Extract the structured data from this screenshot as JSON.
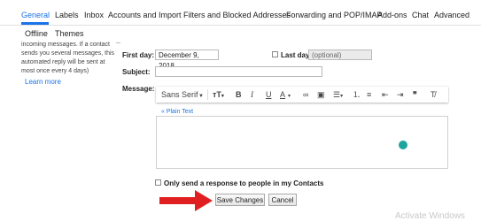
{
  "tabs": {
    "row1": [
      "General",
      "Labels",
      "Inbox",
      "Accounts and Import",
      "Filters and Blocked Addresses",
      "Forwarding and POP/IMAP",
      "Add-ons",
      "Chat",
      "Advanced"
    ],
    "row2": [
      "Offline",
      "Themes"
    ],
    "active": "General"
  },
  "help": {
    "text": "incoming messages. If a contact sends you several messages, this automated reply will be sent at most once every 4 days)",
    "learn_more": "Learn more"
  },
  "form": {
    "first_day_label": "First day:",
    "first_day_value": "December 9, 2018",
    "last_day_label": "Last day:",
    "last_day_placeholder": "(optional)",
    "subject_label": "Subject:",
    "subject_value": "",
    "message_label": "Message:"
  },
  "toolbar": {
    "font": "Sans Serif",
    "font_size_icon": "text-size-icon",
    "bold": "B",
    "italic": "I",
    "underline": "U",
    "text_color": "A"
  },
  "editor": {
    "plain_text_link": "« Plain Text"
  },
  "contacts_only": {
    "label": "Only send a response to people in my Contacts",
    "checked": false
  },
  "buttons": {
    "save": "Save Changes",
    "cancel": "Cancel"
  },
  "colors": {
    "accent": "#1a73e8",
    "arrow": "#e02020"
  },
  "watermark": "Activate Windows"
}
